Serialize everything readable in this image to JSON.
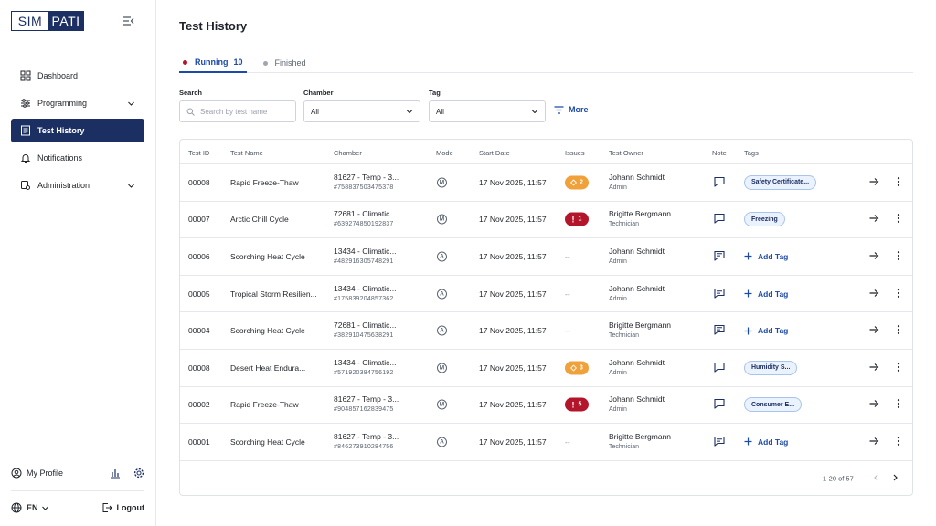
{
  "sidebar": {
    "logo_left": "SIM",
    "logo_right": "PATI",
    "items": [
      {
        "label": "Dashboard"
      },
      {
        "label": "Programming"
      },
      {
        "label": "Test History"
      },
      {
        "label": "Notifications"
      },
      {
        "label": "Administration"
      }
    ],
    "profile_label": "My Profile",
    "language": "EN",
    "logout_label": "Logout"
  },
  "page": {
    "title": "Test History"
  },
  "tabs": [
    {
      "label": "Running",
      "count": "10",
      "dot_color": "#b3162a"
    },
    {
      "label": "Finished",
      "dot_color": "#a0a6ae"
    }
  ],
  "filters": {
    "search_label": "Search",
    "search_placeholder": "Search by test name",
    "chamber_label": "Chamber",
    "chamber_value": "All",
    "tag_label": "Tag",
    "tag_value": "All",
    "more_label": "More"
  },
  "table": {
    "headers": [
      "Test ID",
      "Test Name",
      "Chamber",
      "Mode",
      "Start Date",
      "Issues",
      "Test Owner",
      "Note",
      "Tags"
    ],
    "add_tag_label": "Add Tag",
    "rows": [
      {
        "id": "00008",
        "name": "Rapid Freeze-Thaw",
        "chamber": "81627 - Temp - 3...",
        "serial": "#758837503475378",
        "mode": "M",
        "date": "17 Nov 2025, 11:57",
        "issue_type": "warn",
        "issue_count": "2",
        "owner": "Johann Schmidt",
        "role": "Admin",
        "note": "empty",
        "tag": "Safety Certificate..."
      },
      {
        "id": "00007",
        "name": "Arctic Chill Cycle",
        "chamber": "72681 - Climatic...",
        "serial": "#639274850192837",
        "mode": "M",
        "date": "17 Nov 2025, 11:57",
        "issue_type": "err",
        "issue_count": "1",
        "owner": "Brigitte Bergmann",
        "role": "Technician",
        "note": "empty",
        "tag": "Freezing"
      },
      {
        "id": "00006",
        "name": "Scorching Heat Cycle",
        "chamber": "13434 - Climatic...",
        "serial": "#482916305748291",
        "mode": "A",
        "date": "17 Nov 2025, 11:57",
        "issue_type": "none",
        "issue_count": "--",
        "owner": "Johann Schmidt",
        "role": "Admin",
        "note": "filled",
        "tag": ""
      },
      {
        "id": "00005",
        "name": "Tropical Storm Resilien...",
        "chamber": "13434 - Climatic...",
        "serial": "#175839204857362",
        "mode": "A",
        "date": "17 Nov 2025, 11:57",
        "issue_type": "none",
        "issue_count": "--",
        "owner": "Johann Schmidt",
        "role": "Admin",
        "note": "filled",
        "tag": ""
      },
      {
        "id": "00004",
        "name": "Scorching Heat Cycle",
        "chamber": "72681 - Climatic...",
        "serial": "#382910475638291",
        "mode": "A",
        "date": "17 Nov 2025, 11:57",
        "issue_type": "none",
        "issue_count": "--",
        "owner": "Brigitte Bergmann",
        "role": "Technician",
        "note": "filled",
        "tag": ""
      },
      {
        "id": "00008",
        "name": "Desert Heat Endura...",
        "chamber": "13434 - Climatic...",
        "serial": "#571920384756192",
        "mode": "M",
        "date": "17 Nov 2025, 11:57",
        "issue_type": "warn",
        "issue_count": "3",
        "owner": "Johann Schmidt",
        "role": "Admin",
        "note": "empty",
        "tag": "Humidity S..."
      },
      {
        "id": "00002",
        "name": "Rapid Freeze-Thaw",
        "chamber": "81627 - Temp - 3...",
        "serial": "#904857162839475",
        "mode": "M",
        "date": "17 Nov 2025, 11:57",
        "issue_type": "err",
        "issue_count": "5",
        "owner": "Johann Schmidt",
        "role": "Admin",
        "note": "empty",
        "tag": "Consumer E..."
      },
      {
        "id": "00001",
        "name": "Scorching Heat Cycle",
        "chamber": "81627 - Temp - 3...",
        "serial": "#846273910284756",
        "mode": "A",
        "date": "17 Nov 2025, 11:57",
        "issue_type": "none",
        "issue_count": "--",
        "owner": "Brigitte Bergmann",
        "role": "Technician",
        "note": "filled",
        "tag": ""
      }
    ]
  },
  "pagination": {
    "range": "1-20 of 57"
  },
  "colors": {
    "brand": "#1c2f63",
    "accent": "#1c4aa6",
    "warning": "#f0a13a",
    "error": "#b3162a"
  }
}
